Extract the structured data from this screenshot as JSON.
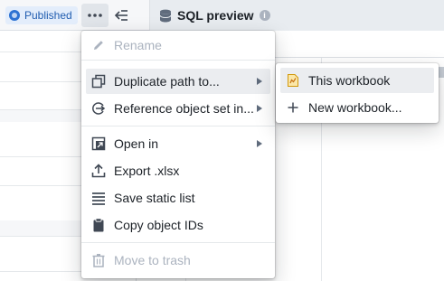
{
  "toolbar": {
    "published_label": "Published",
    "more_icon": "more-horizontal-icon",
    "collapse_icon": "collapse-left-icon"
  },
  "tab": {
    "icon": "database-icon",
    "title": "SQL preview",
    "info_icon": "i"
  },
  "main_menu": {
    "items": [
      {
        "label": "Rename",
        "icon": "edit-icon",
        "disabled": true
      },
      {
        "label": "Duplicate path to...",
        "icon": "duplicate-icon",
        "submenu": true,
        "active": true
      },
      {
        "label": "Reference object set in...",
        "icon": "reference-icon",
        "submenu": true
      },
      {
        "label": "Open in",
        "icon": "open-in-icon",
        "submenu": true
      },
      {
        "label": "Export .xlsx",
        "icon": "export-icon"
      },
      {
        "label": "Save static list",
        "icon": "list-icon"
      },
      {
        "label": "Copy object IDs",
        "icon": "clipboard-icon"
      },
      {
        "label": "Move to trash",
        "icon": "trash-icon",
        "disabled": true
      }
    ]
  },
  "sub_menu": {
    "items": [
      {
        "label": "This workbook",
        "icon": "workbook-icon",
        "active": true
      },
      {
        "label": "New workbook...",
        "icon": "plus-icon"
      }
    ]
  },
  "colors": {
    "accent": "#2d72d2",
    "badge_bg": "#e3edfb",
    "disabled_text": "#abb3bf",
    "hover_bg": "#ebedf0"
  }
}
